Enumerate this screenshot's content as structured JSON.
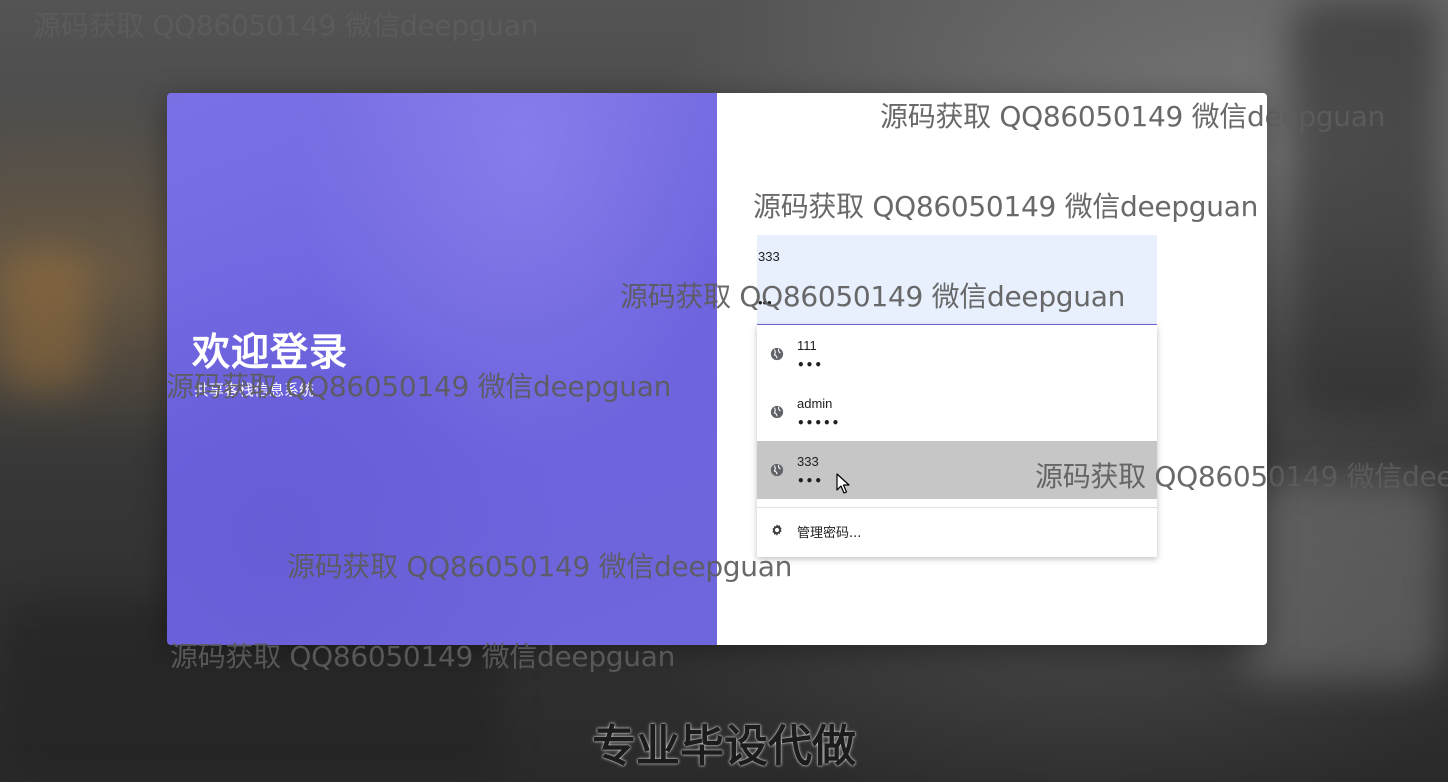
{
  "login": {
    "title": "欢迎登录",
    "subtitle": "共享客栈信息系统"
  },
  "form": {
    "username_value": "333",
    "password_value": "•••"
  },
  "autofill": {
    "items": [
      {
        "user": "111",
        "pass": "•••",
        "icon": "globe-icon"
      },
      {
        "user": "admin",
        "pass": "•••••",
        "icon": "globe-icon"
      },
      {
        "user": "333",
        "pass": "•••",
        "icon": "globe-icon",
        "highlighted": true
      }
    ],
    "manage_label": "管理密码...",
    "manage_icon": "gear-icon"
  },
  "watermark_text": "源码获取 QQ86050149 微信deepguan",
  "caption": "专业毕设代做",
  "colors": {
    "accent": "#6e66dc",
    "field_bg": "#e8f0fe",
    "hover_bg": "#c6c6c6"
  }
}
